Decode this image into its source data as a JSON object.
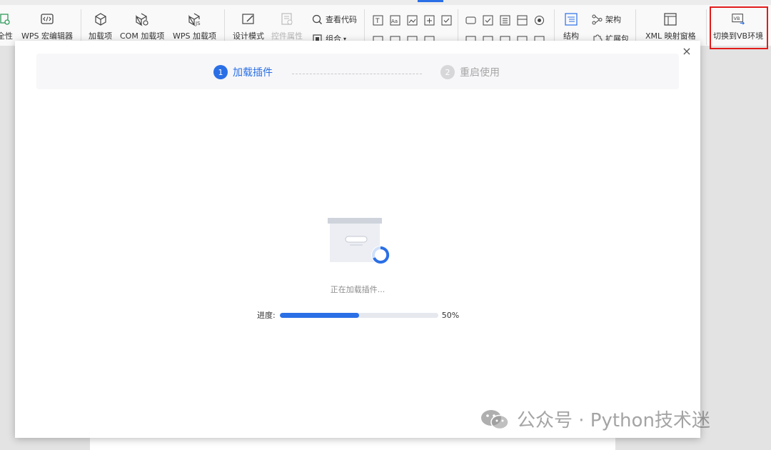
{
  "ribbon": {
    "items": [
      {
        "label": "全性",
        "icon": "shield-doc-icon"
      },
      {
        "label": "WPS 宏编辑器",
        "icon": "code-editor-icon"
      },
      {
        "label": "加载项",
        "icon": "cube-icon"
      },
      {
        "label": "COM 加载项",
        "icon": "cube-gear-icon"
      },
      {
        "label": "WPS 加载项",
        "icon": "cube-js-icon"
      },
      {
        "label": "设计模式",
        "icon": "design-mode-icon"
      },
      {
        "label": "控件属性",
        "icon": "control-properties-icon"
      }
    ],
    "view_code_label": "查看代码",
    "group_label": "组合",
    "structure_label": "结构",
    "schema_label": "架构",
    "expansion_pack_label": "扩展包",
    "xml_mapping_label": "XML 映射窗格",
    "switch_vb_label": "切换到VB环境",
    "switch_vb_badge": "VB"
  },
  "dialog": {
    "steps": [
      {
        "number": "1",
        "label": "加载插件"
      },
      {
        "number": "2",
        "label": "重启使用"
      }
    ],
    "loading_text": "正在加载插件...",
    "progress": {
      "label": "进度:",
      "value": 0.5,
      "percent_text": "50%"
    },
    "close_symbol": "×"
  },
  "watermark": {
    "text": "公众号 · Python技术迷"
  },
  "colors": {
    "accent": "#2a6fe6",
    "highlight": "#e21b1b"
  }
}
